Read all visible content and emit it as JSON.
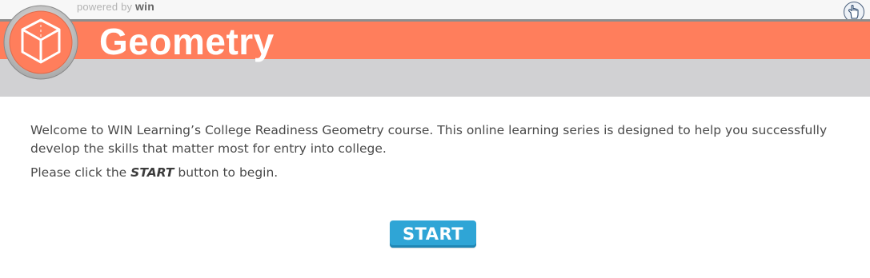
{
  "header": {
    "powered_by_text": "powered by",
    "powered_by_brand": "win",
    "course_title": "Geometry",
    "banner_color": "#ff7e5c",
    "logo_icon": "cube-icon",
    "help_icon": "hand-pointer-icon"
  },
  "intro": {
    "paragraph1": "Welcome to WIN Learning’s College Readiness Geometry course. This online learning series is designed to help you successfully develop the skills that matter most for entry into college.",
    "paragraph2_before": "Please click the ",
    "paragraph2_emphasis": "START",
    "paragraph2_after": " button to begin."
  },
  "actions": {
    "start_label": "START",
    "start_color": "#2fa5d6"
  }
}
